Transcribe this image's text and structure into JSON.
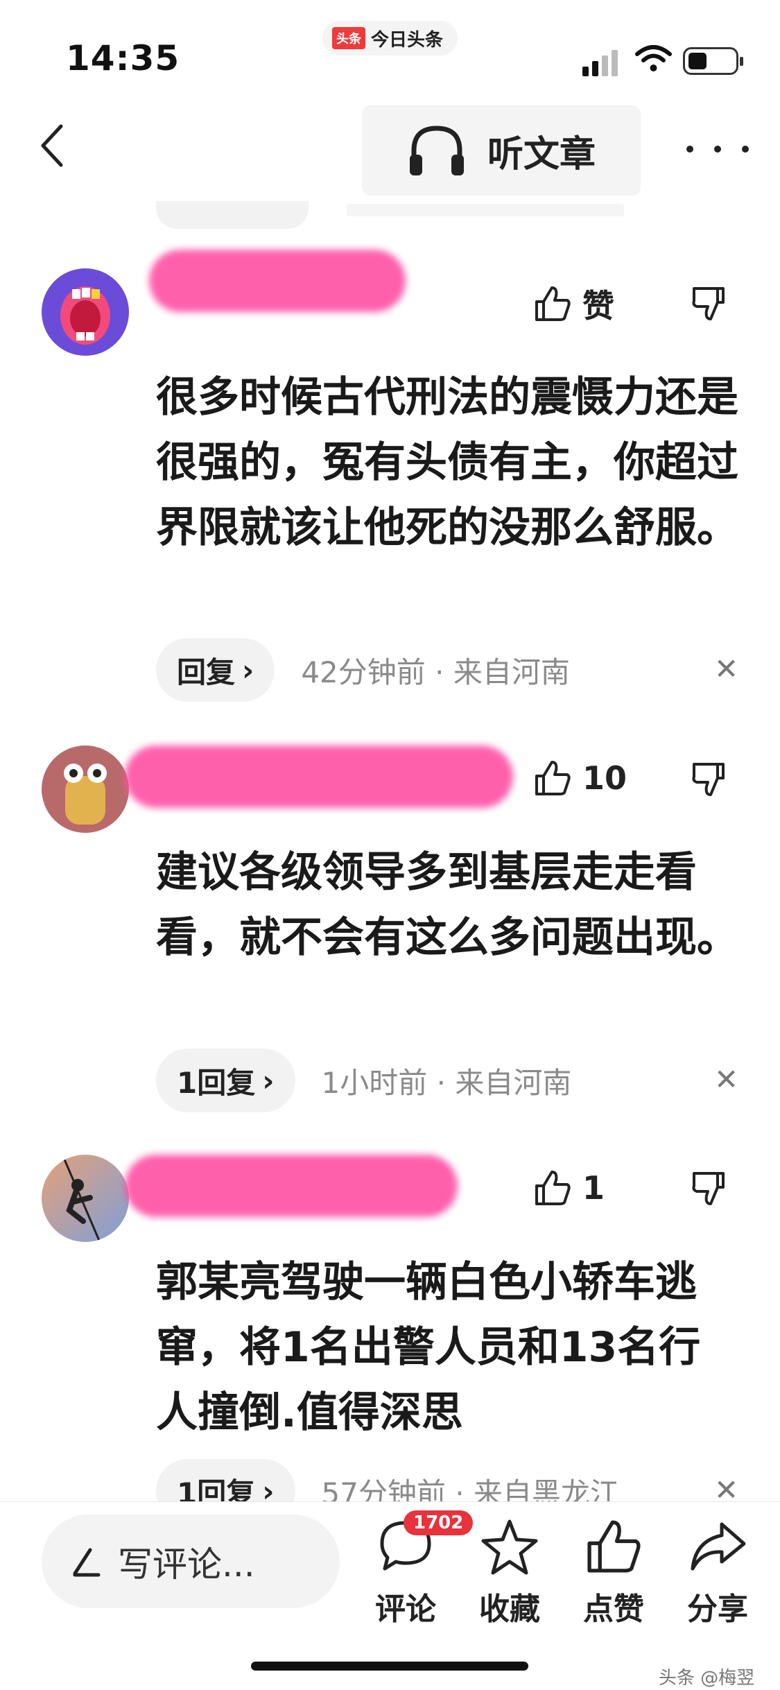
{
  "status_bar": {
    "time": "14:35",
    "app_logo": "头条",
    "app_name": "今日头条"
  },
  "nav": {
    "listen_label": "听文章",
    "icons": [
      "back-chevron-icon",
      "headphones-icon",
      "more-dots-icon"
    ]
  },
  "comments": [
    {
      "like_label": "赞",
      "text": "很多时候古代刑法的震慑力还是很强的，冤有头债有主，你超过界限就该让他死的没那么舒服。",
      "reply_label": "回复",
      "meta": "42分钟前 · 来自河南"
    },
    {
      "like_label": "10",
      "text": "建议各级领导多到基层走走看看，就不会有这么多问题出现。",
      "reply_label": "1回复",
      "meta": "1小时前 · 来自河南"
    },
    {
      "like_label": "1",
      "text": "郭某亮驾驶一辆白色小轿车逃窜，将1名出警人员和13名行人撞倒.值得深思",
      "reply_label": "1回复",
      "meta": "57分钟前 · 来自黑龙江"
    }
  ],
  "bottom_bar": {
    "write_placeholder": "写评论...",
    "comment_label": "评论",
    "comment_count": "1702",
    "favorite_label": "收藏",
    "like_label": "点赞",
    "share_label": "分享"
  },
  "watermark": "头条 @梅翌",
  "colors": {
    "accent_red": "#e8323c",
    "redaction_pink": "#ff4fa3",
    "meta_gray": "#8a8a8a"
  }
}
